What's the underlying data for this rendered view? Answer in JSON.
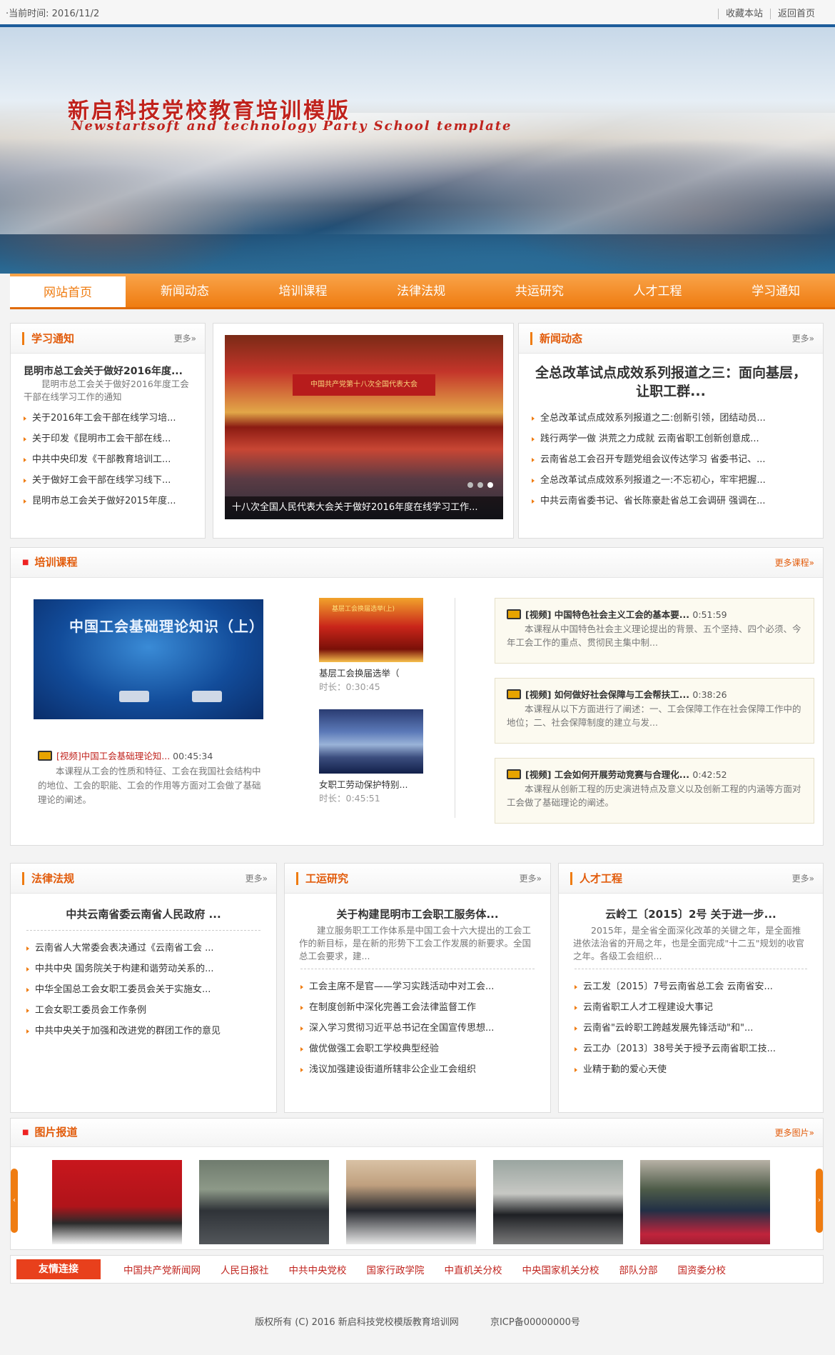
{
  "topbar": {
    "date_label": "·当前时间: ",
    "date": "2016/11/2",
    "favorite": "收藏本站",
    "home": "返回首页"
  },
  "banner": {
    "title_cn": "新启科技党校教育培训模版",
    "title_en": "Newstartsoft and technology Party School template"
  },
  "nav": [
    "网站首页",
    "新闻动态",
    "培训课程",
    "法律法规",
    "共运研究",
    "人才工程",
    "学习通知"
  ],
  "study_notice": {
    "title": "学习通知",
    "more": "更多»",
    "featured_title": "昆明市总工会关于做好2016年度...",
    "featured_desc": "昆明市总工会关于做好2016年度工会干部在线学习工作的通知",
    "items": [
      "关于2016年工会干部在线学习培...",
      "关于印发《昆明市工会干部在线...",
      "中共中央印发《干部教育培训工...",
      "关于做好工会干部在线学习线下...",
      "昆明市总工会关于做好2015年度..."
    ]
  },
  "slide": {
    "stage_text": "中国共产党第十八次全国代表大会",
    "caption": "十八次全国人民代表大会关于做好2016年度在线学习工作..."
  },
  "news": {
    "title": "新闻动态",
    "more": "更多»",
    "headline": "全总改革试点成效系列报道之三：面向基层，让职工群...",
    "items": [
      "全总改革试点成效系列报道之二:创新引领，团结动员...",
      "践行两学一做 洪荒之力成就 云南省职工创新创意成...",
      "云南省总工会召开专题党组会议传达学习 省委书记、...",
      "全总改革试点成效系列报道之一:不忘初心，牢牢把握...",
      "中共云南省委书记、省长陈豪赴省总工会调研 强调在..."
    ]
  },
  "courses": {
    "title": "培训课程",
    "more": "更多课程»",
    "big": {
      "screen_title": "中国工会基础理论知识（上）",
      "tag": "[视频]",
      "name": "中国工会基础理论知...",
      "time": "00:45:34",
      "desc": "本课程从工会的性质和特征、工会在我国社会结构中的地位、工会的职能、工会的作用等方面对工会做了基础理论的阐述。"
    },
    "small": [
      {
        "screen_title": "基层工会换届选举(上)",
        "name": "基层工会换届选举（",
        "time_label": "时长：",
        "time": "0:30:45"
      },
      {
        "name": "女职工劳动保护特别...",
        "time_label": "时长：",
        "time": "0:45:51"
      }
    ],
    "cards": [
      {
        "tag": "[视频]",
        "name": "中国特色社会主义工会的基本要...",
        "time": "0:51:59",
        "desc": "本课程从中国特色社会主义理论提出的背景、五个坚持、四个必须、今年工会工作的重点、贯彻民主集中制..."
      },
      {
        "tag": "[视频]",
        "name": "如何做好社会保障与工会帮扶工...",
        "time": "0:38:26",
        "desc": "本课程从以下方面进行了阐述：一、工会保障工作在社会保障工作中的地位；二、社会保障制度的建立与发..."
      },
      {
        "tag": "[视频]",
        "name": "工会如何开展劳动竞赛与合理化...",
        "time": "0:42:52",
        "desc": "本课程从创新工程的历史演进特点及意义以及创新工程的内涵等方面对工会做了基础理论的阐述。"
      }
    ]
  },
  "law": {
    "title": "法律法规",
    "more": "更多»",
    "featured": "中共云南省委云南省人民政府 ...",
    "items": [
      "云南省人大常委会表决通过《云南省工会 ...",
      "中共中央 国务院关于构建和谐劳动关系的...",
      "中华全国总工会女职工委员会关于实施女...",
      "工会女职工委员会工作条例",
      "中共中央关于加强和改进党的群团工作的意见"
    ]
  },
  "research": {
    "title": "工运研究",
    "more": "更多»",
    "featured": "关于构建昆明市工会职工服务体...",
    "desc": "建立服务职工工作体系是中国工会十六大提出的工会工作的新目标，是在新的形势下工会工作发展的新要求。全国总工会要求，建...",
    "items": [
      "工会主席不是官——学习实践活动中对工会...",
      "在制度创新中深化完善工会法律监督工作",
      "深入学习贯彻习近平总书记在全国宣传思想...",
      "做优做强工会职工学校典型经验",
      "浅议加强建设街道所辖非公企业工会组织"
    ]
  },
  "talent": {
    "title": "人才工程",
    "more": "更多»",
    "featured": "云岭工〔2015〕2号 关于进一步...",
    "desc": "2015年，是全省全面深化改革的关键之年，是全面推进依法治省的开局之年，也是全面完成\"十二五\"规划的收官之年。各级工会组织...",
    "items": [
      "云工发〔2015〕7号云南省总工会 云南省安...",
      "云南省职工人才工程建设大事记",
      "云南省\"云岭职工跨越发展先锋活动\"和\"...",
      "云工办〔2013〕38号关于授予云南省职工技...",
      "业精于勤的爱心天使"
    ]
  },
  "photos": {
    "title": "图片报道",
    "more": "更多图片»"
  },
  "friends": {
    "label": "友情连接",
    "items": [
      "中国共产党新闻网",
      "人民日报社",
      "中共中央党校",
      "国家行政学院",
      "中直机关分校",
      "中央国家机关分校",
      "部队分部",
      "国资委分校"
    ]
  },
  "footer": {
    "copyright": "版权所有 (C) 2016 新启科技党校模版教育培训网",
    "icp": "京ICP备00000000号"
  }
}
